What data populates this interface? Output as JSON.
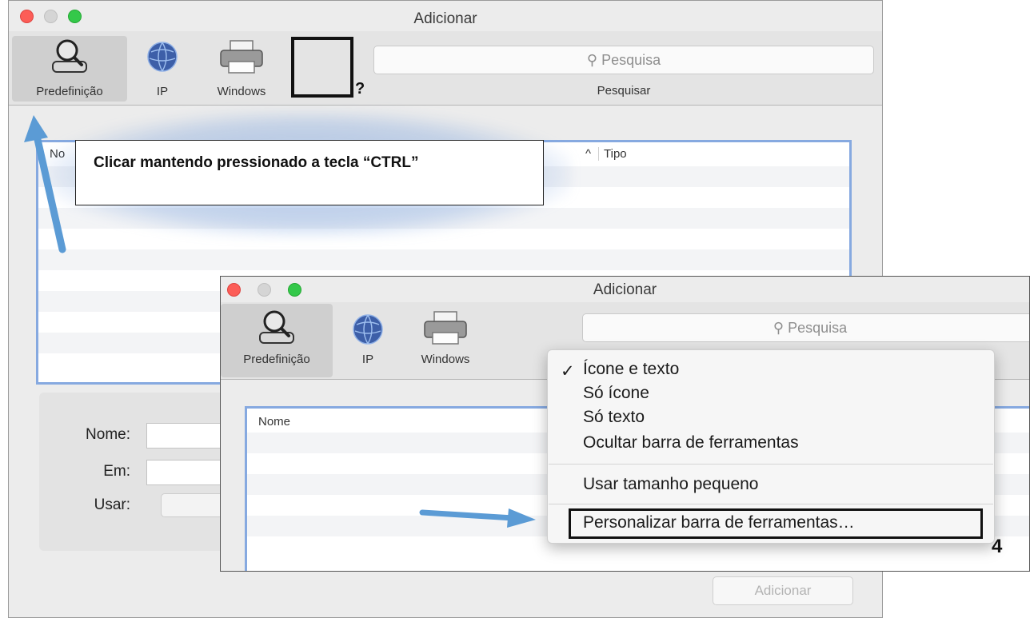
{
  "back_window": {
    "title": "Adicionar",
    "toolbar": {
      "items": [
        {
          "label": "Predefinição",
          "icon": "magnifier-person-icon",
          "selected": true
        },
        {
          "label": "IP",
          "icon": "globe-icon",
          "selected": false
        },
        {
          "label": "Windows",
          "icon": "printer-icon",
          "selected": false
        }
      ],
      "search_placeholder": "Pesquisa",
      "search_label": "Pesquisar"
    },
    "list_columns": [
      "Nome",
      "Tipo"
    ],
    "list_column_fragment": "No",
    "sort_glyph": "^",
    "form": {
      "nome_label": "Nome:",
      "em_label": "Em:",
      "usar_label": "Usar:"
    },
    "add_button": "Adicionar"
  },
  "annotations": {
    "callout_text": "Clicar mantendo pressionado a tecla “CTRL”",
    "question_mark": "?",
    "step_number": "4",
    "arrow_color": "#5b9bd5"
  },
  "front_window": {
    "title": "Adicionar",
    "toolbar": {
      "items": [
        {
          "label": "Predefinição",
          "icon": "magnifier-person-icon",
          "selected": true
        },
        {
          "label": "IP",
          "icon": "globe-icon",
          "selected": false
        },
        {
          "label": "Windows",
          "icon": "printer-icon",
          "selected": false
        }
      ],
      "search_placeholder": "Pesquisa"
    },
    "list_column": "Nome"
  },
  "context_menu": {
    "check_glyph": "✓",
    "items": [
      {
        "label": "Ícone e texto",
        "checked": true
      },
      {
        "label": "Só ícone",
        "checked": false
      },
      {
        "label": "Só texto",
        "checked": false
      },
      {
        "label": "Ocultar barra de ferramentas",
        "checked": false
      },
      {
        "label": "Usar tamanho pequeno",
        "checked": false
      },
      {
        "label": "Personalizar barra de ferramentas…",
        "checked": false
      }
    ]
  },
  "colors": {
    "traffic_red": "#fc5d57",
    "traffic_green": "#34c84a",
    "list_border": "#86a9e0"
  }
}
